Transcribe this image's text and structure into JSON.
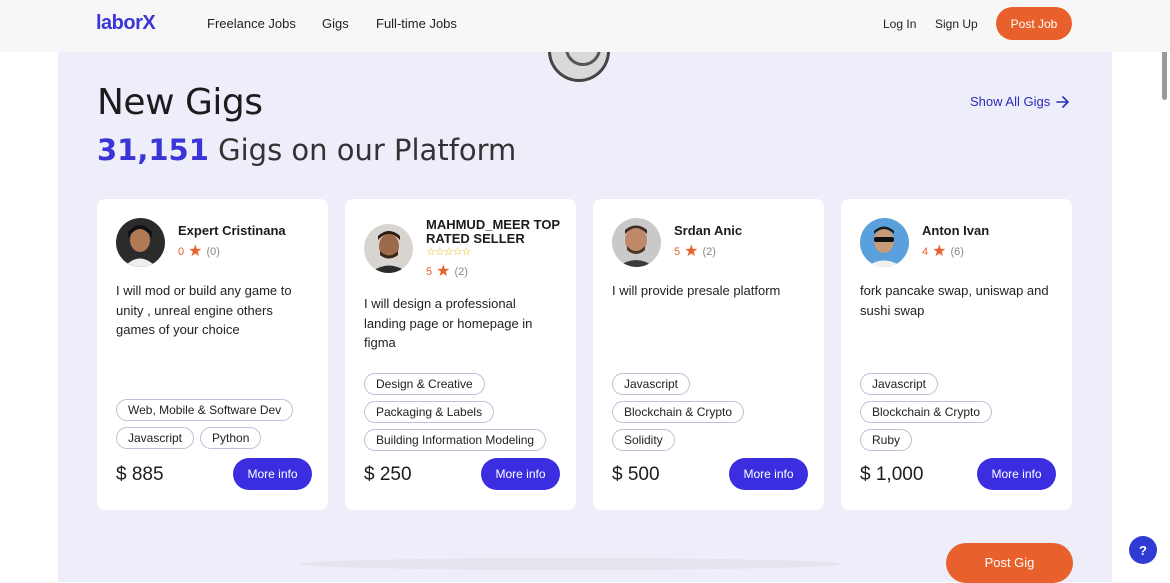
{
  "header": {
    "logo": "laborX",
    "nav": [
      "Freelance Jobs",
      "Gigs",
      "Full-time Jobs"
    ],
    "login": "Log In",
    "signup": "Sign Up",
    "post_job": "Post Job"
  },
  "section": {
    "title": "New Gigs",
    "count": "31,151",
    "subtitle_rest": "Gigs on our Platform",
    "show_all": "Show All Gigs"
  },
  "gigs": [
    {
      "name": "Expert Cristinana",
      "rating": "0",
      "reviews": "(0)",
      "description": "I will mod or build any game to unity , unreal engine others games of your choice",
      "tags": [
        "Web, Mobile & Software Dev",
        "Javascript",
        "Python"
      ],
      "price": "$ 885",
      "button": "More info"
    },
    {
      "name": "MAHMUD_MEER TOP RATED SELLER",
      "rating": "5",
      "reviews": "(2)",
      "description": "I will design a professional landing page or homepage in figma",
      "tags": [
        "Design & Creative",
        "Packaging & Labels",
        "Building Information Modeling"
      ],
      "price": "$ 250",
      "button": "More info"
    },
    {
      "name": "Srdan Anic",
      "rating": "5",
      "reviews": "(2)",
      "description": "I will provide presale platform",
      "tags": [
        "Javascript",
        "Blockchain & Crypto",
        "Solidity"
      ],
      "price": "$ 500",
      "button": "More info"
    },
    {
      "name": "Anton Ivan",
      "rating": "4",
      "reviews": "(6)",
      "description": "fork pancake swap, uniswap and sushi swap",
      "tags": [
        "Javascript",
        "Blockchain & Crypto",
        "Ruby"
      ],
      "price": "$ 1,000",
      "button": "More info"
    }
  ],
  "post_gig": "Post Gig",
  "help": "?",
  "colors": {
    "brand": "#3b34d6",
    "accent": "#e8612c",
    "button": "#3b2ee0",
    "section_bg": "#eeeefb"
  }
}
